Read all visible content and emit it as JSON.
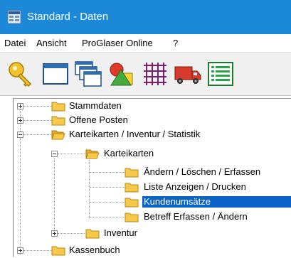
{
  "window": {
    "title": "Standard - Daten",
    "titlebar_color": "#1b88d8",
    "icon": "app-grid-icon"
  },
  "menu": {
    "items": [
      "Datei",
      "Ansicht",
      "ProGlaser Online",
      "?"
    ]
  },
  "toolbar": {
    "buttons": [
      {
        "icon": "key-icon"
      },
      {
        "icon": "window-icon"
      },
      {
        "icon": "cascade-windows-icon"
      },
      {
        "icon": "shapes-icon"
      },
      {
        "icon": "grid-icon"
      },
      {
        "icon": "truck-icon"
      },
      {
        "icon": "list-icon"
      }
    ]
  },
  "tree": {
    "selection_color": "#0a64c8",
    "nodes": [
      {
        "label": "Stammdaten",
        "level": 0,
        "expander": "plus"
      },
      {
        "label": "Offene Posten",
        "level": 0,
        "expander": "plus"
      },
      {
        "label": "Karteikarten / Inventur / Statistik",
        "level": 0,
        "expander": "minus"
      },
      {
        "label": "Karteikarten",
        "level": 1,
        "expander": "minus"
      },
      {
        "label": "Ändern / Löschen / Erfassen",
        "level": 2,
        "expander": "none"
      },
      {
        "label": "Liste Anzeigen / Drucken",
        "level": 2,
        "expander": "none"
      },
      {
        "label": "Kundenumsätze",
        "level": 2,
        "expander": "none",
        "selected": true
      },
      {
        "label": "Betreff Erfassen / Ändern",
        "level": 2,
        "expander": "none"
      },
      {
        "label": "Inventur",
        "level": 1,
        "expander": "plus"
      },
      {
        "label": "Kassenbuch",
        "level": 0,
        "expander": "plus"
      }
    ]
  }
}
